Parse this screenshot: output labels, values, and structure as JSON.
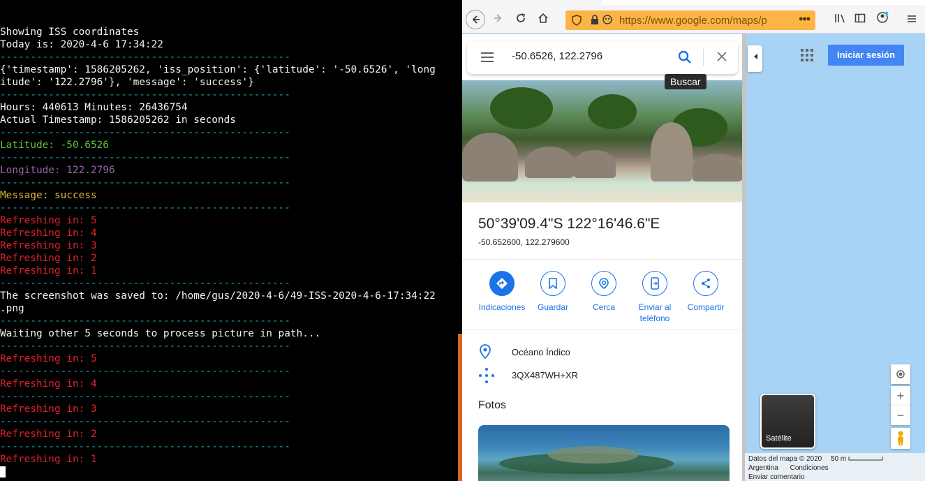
{
  "terminal": {
    "lines": [
      {
        "text": "",
        "color": "white"
      },
      {
        "text": "Showing ISS coordinates",
        "color": "white"
      },
      {
        "text": "Today is: 2020-4-6 17:34:22",
        "color": "white"
      },
      {
        "text": "------------------------------------------------",
        "color": "sep"
      },
      {
        "text": "{'timestamp': 1586205262, 'iss_position': {'latitude': '-50.6526', 'long",
        "color": "white"
      },
      {
        "text": "itude': '122.2796'}, 'message': 'success'}",
        "color": "white"
      },
      {
        "text": "------------------------------------------------",
        "color": "sep"
      },
      {
        "text": "Hours: 440613 Minutes: 26436754",
        "color": "white"
      },
      {
        "text": "Actual Timestamp: 1586205262 in seconds",
        "color": "white"
      },
      {
        "text": "------------------------------------------------",
        "color": "sep"
      },
      {
        "text": "Latitude: -50.6526",
        "color": "green"
      },
      {
        "text": "------------------------------------------------",
        "color": "sep"
      },
      {
        "text": "Longitude: 122.2796",
        "color": "purple"
      },
      {
        "text": "------------------------------------------------",
        "color": "sep"
      },
      {
        "text": "Message: success",
        "color": "yellow"
      },
      {
        "text": "------------------------------------------------",
        "color": "sep"
      },
      {
        "text": "Refreshing in: 5",
        "color": "red"
      },
      {
        "text": "Refreshing in: 4",
        "color": "red"
      },
      {
        "text": "Refreshing in: 3",
        "color": "red"
      },
      {
        "text": "Refreshing in: 2",
        "color": "red"
      },
      {
        "text": "Refreshing in: 1",
        "color": "red"
      },
      {
        "text": "------------------------------------------------",
        "color": "sep"
      },
      {
        "text": "The screenshot was saved to: /home/gus/2020-4-6/49-ISS-2020-4-6-17:34:22",
        "color": "white"
      },
      {
        "text": ".png",
        "color": "white"
      },
      {
        "text": "------------------------------------------------",
        "color": "sep"
      },
      {
        "text": "Waiting other 5 seconds to process picture in path...",
        "color": "white"
      },
      {
        "text": "------------------------------------------------",
        "color": "sep"
      },
      {
        "text": "Refreshing in: 5",
        "color": "red"
      },
      {
        "text": "------------------------------------------------",
        "color": "sep"
      },
      {
        "text": "Refreshing in: 4",
        "color": "red"
      },
      {
        "text": "------------------------------------------------",
        "color": "sep"
      },
      {
        "text": "Refreshing in: 3",
        "color": "red"
      },
      {
        "text": "------------------------------------------------",
        "color": "sep"
      },
      {
        "text": "Refreshing in: 2",
        "color": "red"
      },
      {
        "text": "------------------------------------------------",
        "color": "sep"
      },
      {
        "text": "Refreshing in: 1",
        "color": "red"
      }
    ]
  },
  "browser": {
    "url": "https://www.google.com/maps/p",
    "url_more": "•••"
  },
  "maps": {
    "search_value": "-50.6526, 122.2796",
    "search_tooltip": "Buscar",
    "place_title": "50°39'09.4\"S 122°16'46.6\"E",
    "place_coords": "-50.652600, 122.279600",
    "actions": [
      {
        "label": "Indicaciones"
      },
      {
        "label": "Guardar"
      },
      {
        "label": "Cerca"
      },
      {
        "label": "Enviar al teléfono"
      },
      {
        "label": "Compartir"
      }
    ],
    "location_name": "Océano Índico",
    "plus_code": "3QX487WH+XR",
    "photos_title": "Fotos",
    "signin_label": "Iniciar sesión",
    "satellite_label": "Satélite",
    "zoom_in": "+",
    "zoom_out": "−",
    "attribution_line1": "Datos del mapa © 2020",
    "scale": "50 m",
    "attribution_country": "Argentina",
    "attribution_terms": "Condiciones",
    "attribution_feedback": "Enviar comentario"
  },
  "colors": {
    "accent": "#1a73e8",
    "url_bar": "#fcb545",
    "map_water": "#a8d3f5",
    "signin": "#4285f4"
  }
}
